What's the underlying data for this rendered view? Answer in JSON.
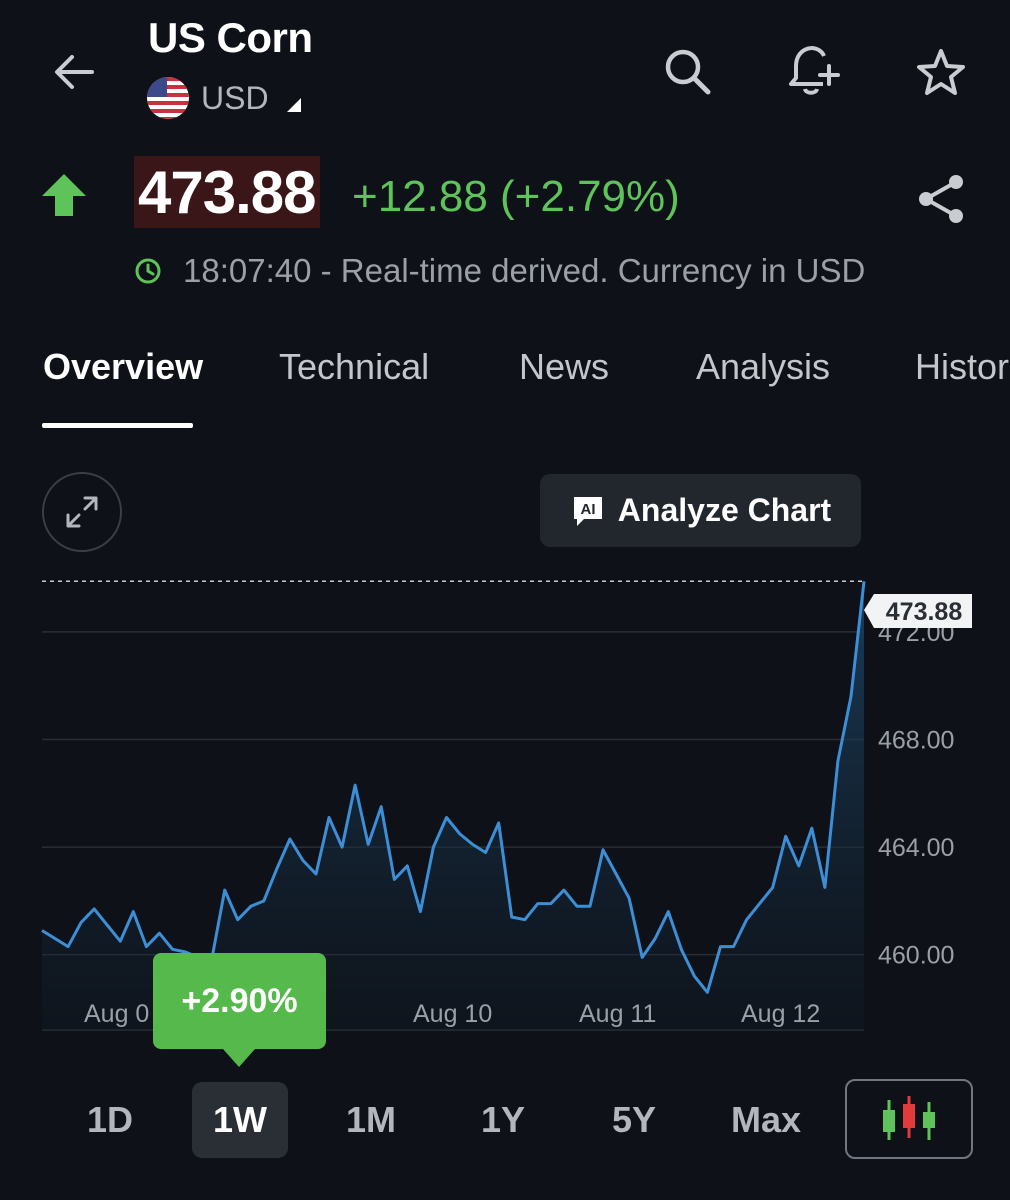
{
  "header": {
    "title": "US Corn",
    "currency": "USD",
    "icons": [
      "back-arrow-icon",
      "search-icon",
      "add-alert-icon",
      "star-icon"
    ]
  },
  "quote": {
    "price": "473.88",
    "change": "+12.88 (+2.79%)",
    "direction": "up",
    "status": "18:07:40 - Real-time derived. Currency in USD"
  },
  "tabs": [
    "Overview",
    "Technical",
    "News",
    "Analysis",
    "Histor"
  ],
  "active_tab": "Overview",
  "chart_controls": {
    "analyze_label": "Analyze Chart",
    "ai_badge": "AI"
  },
  "chart_data": {
    "type": "line",
    "title": "",
    "xlabel": "",
    "ylabel": "",
    "last_price_label": "473.88",
    "y_ticks": [
      "472.00",
      "468.00",
      "464.00",
      "460.00"
    ],
    "x_ticks": [
      "Aug 0",
      "Aug 10",
      "Aug 11",
      "Aug 12"
    ],
    "ylim": [
      457.2,
      474.3
    ],
    "series": [
      {
        "values": [
          460.9,
          460.6,
          460.3,
          461.2,
          461.7,
          461.1,
          460.5,
          461.6,
          460.3,
          460.8,
          460.2,
          460.1,
          459.9,
          459.8,
          462.4,
          461.3,
          461.8,
          462.0,
          463.2,
          464.3,
          463.5,
          463.0,
          465.1,
          464.0,
          466.3,
          464.1,
          465.5,
          462.8,
          463.3,
          461.6,
          464.0,
          465.1,
          464.5,
          464.1,
          463.8,
          464.9,
          461.4,
          461.3,
          461.9,
          461.9,
          462.4,
          461.8,
          461.8,
          463.9,
          463.0,
          462.1,
          459.9,
          460.6,
          461.6,
          460.2,
          459.2,
          458.6,
          460.3,
          460.3,
          461.3,
          461.9,
          462.5,
          464.4,
          463.3,
          464.7,
          462.5,
          467.2,
          469.6,
          473.88
        ]
      }
    ],
    "change_badge": "+2.90%",
    "grid": true
  },
  "ranges": [
    "1D",
    "1W",
    "1M",
    "1Y",
    "5Y",
    "Max"
  ],
  "active_range": "1W",
  "colors": {
    "background": "#0e1117",
    "up": "#5ec35a",
    "line": "#3c8fd6",
    "price_bg": "#3a1618",
    "tooltip": "#55b94b"
  }
}
